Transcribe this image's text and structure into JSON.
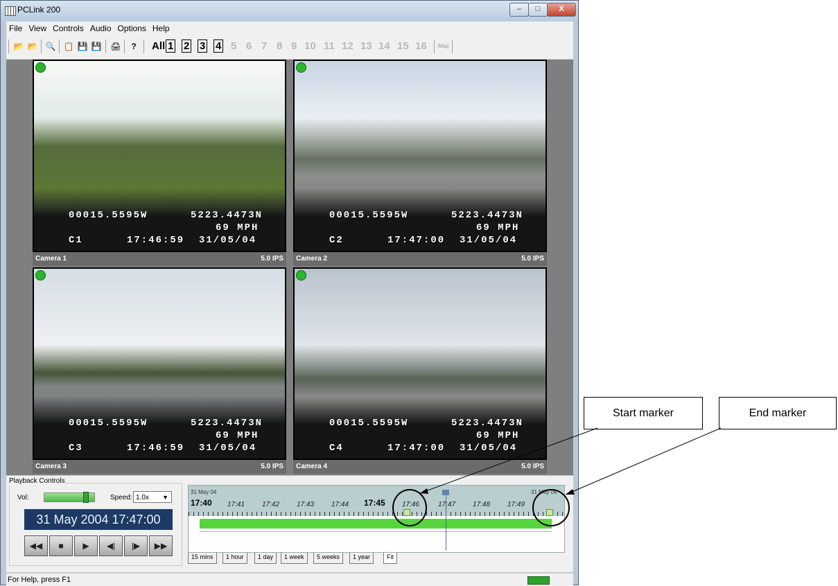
{
  "window": {
    "title": "PCLink 200",
    "buttons": [
      "–",
      "□",
      "X"
    ]
  },
  "menu": [
    "File",
    "View",
    "Controls",
    "Audio",
    "Options",
    "Help"
  ],
  "toolbar": {
    "all_label": "All",
    "cameras": [
      "1",
      "2",
      "3",
      "4",
      "5",
      "6",
      "7",
      "8",
      "9",
      "10",
      "11",
      "12",
      "13",
      "14",
      "15",
      "16"
    ],
    "map_label": "Map"
  },
  "cameras": [
    {
      "label": "Camera 1",
      "ips": "5.0 IPS",
      "lon": "00015.5595W",
      "lat": "5223.4473N",
      "speed": "69 MPH",
      "id": "C1",
      "time": "17:46:59",
      "date": "31/05/04"
    },
    {
      "label": "Camera 2",
      "ips": "5.0 IPS",
      "lon": "00015.5595W",
      "lat": "5223.4473N",
      "speed": "69 MPH",
      "id": "C2",
      "time": "17:47:00",
      "date": "31/05/04"
    },
    {
      "label": "Camera 3",
      "ips": "5.0 IPS",
      "lon": "00015.5595W",
      "lat": "5223.4473N",
      "speed": "69 MPH",
      "id": "C3",
      "time": "17:46:59",
      "date": "31/05/04"
    },
    {
      "label": "Camera 4",
      "ips": "5.0 IPS",
      "lon": "00015.5595W",
      "lat": "5223.4473N",
      "speed": "69 MPH",
      "id": "C4",
      "time": "17:47:00",
      "date": "31/05/04"
    }
  ],
  "playback": {
    "title": "Playback Controls",
    "vol_label": "Vol:",
    "volume_level": 0.85,
    "speed_label": "Speed:",
    "speed_value": "1.0x",
    "clock": "31 May 2004  17:47:00",
    "buttons": [
      "◀◀",
      "■",
      "▶",
      "◀|",
      "|▶",
      "▶▶"
    ]
  },
  "timeline": {
    "start_date": "31 May 04",
    "end_date": "31 May 04",
    "major_start": "17:40",
    "major_mid": "17:45",
    "ticks": [
      "17:41",
      "17:42",
      "17:43",
      "17:44",
      "17:46",
      "17:47",
      "17:48",
      "17:49"
    ],
    "tabs": [
      "15 mins",
      "1 hour",
      "1 day",
      "1 week",
      "5 weeks",
      "1 year",
      "Fit"
    ],
    "active_tab": "Fit"
  },
  "status": {
    "text": "For Help, press F1"
  },
  "callouts": {
    "start": "Start marker",
    "end": "End marker"
  }
}
